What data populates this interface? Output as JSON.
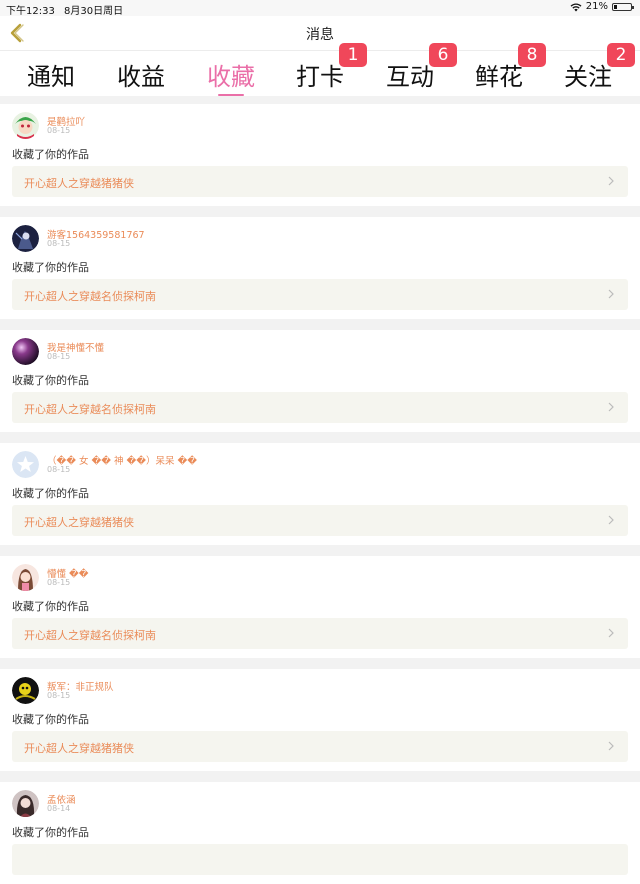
{
  "statusbar": {
    "time": "下午12:33",
    "date": "8月30日周日",
    "battery": "21%",
    "battery_level": 0.21
  },
  "header": {
    "title": "消息"
  },
  "tabs": [
    {
      "label": "通知",
      "badge": ""
    },
    {
      "label": "收益",
      "badge": ""
    },
    {
      "label": "收藏",
      "badge": "",
      "active": true
    },
    {
      "label": "打卡",
      "badge": "1"
    },
    {
      "label": "互动",
      "badge": "6"
    },
    {
      "label": "鲜花",
      "badge": "8"
    },
    {
      "label": "关注",
      "badge": "2"
    }
  ],
  "colors": {
    "accent": "#ea6fa8",
    "username": "#ea8b58",
    "badge": "#f0475a",
    "card_bg": "#f5f5ef"
  },
  "items": [
    {
      "username": "是鹳拉吖",
      "date": "08-15",
      "action": "收藏了你的作品",
      "work": "开心超人之穿越猪猪侠",
      "avatar": "avatar-green-hair"
    },
    {
      "username": "游客1564359581767",
      "date": "08-15",
      "action": "收藏了你的作品",
      "work": "开心超人之穿越名侦探柯南",
      "avatar": "avatar-dark-character"
    },
    {
      "username": "我是神懂不懂",
      "date": "08-15",
      "action": "收藏了你的作品",
      "work": "开心超人之穿越名侦探柯南",
      "avatar": "avatar-purple-glow"
    },
    {
      "username": "（�� 女 �� 神 ��）呆呆 ��",
      "date": "08-15",
      "action": "收藏了你的作品",
      "work": "开心超人之穿越猪猪侠",
      "avatar": "avatar-default-star"
    },
    {
      "username": "懵懂 ��",
      "date": "08-15",
      "action": "收藏了你的作品",
      "work": "开心超人之穿越名侦探柯南",
      "avatar": "avatar-anime-girl"
    },
    {
      "username": "叛军：非正规队",
      "date": "08-15",
      "action": "收藏了你的作品",
      "work": "开心超人之穿越猪猪侠",
      "avatar": "avatar-black-yellow"
    },
    {
      "username": "孟依涵",
      "date": "08-14",
      "action": "收藏了你的作品",
      "work": "",
      "avatar": "avatar-portrait"
    }
  ]
}
